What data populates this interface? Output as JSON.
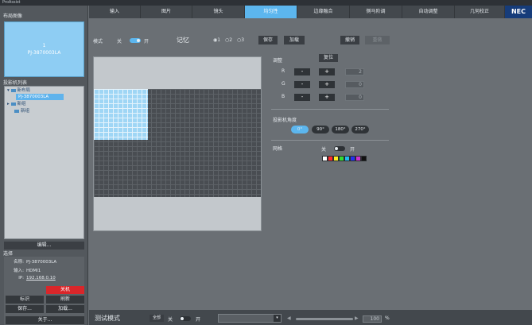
{
  "app": {
    "title": "ProAssist"
  },
  "left": {
    "layout_label": "布局图像",
    "thumbnail": {
      "number": "1",
      "device": "PJ-3870003LA"
    },
    "projector_list_label": "投影机列表",
    "tree": [
      {
        "label": "新布局"
      },
      {
        "label": "PJ-3870003LA"
      },
      {
        "label": "新组"
      },
      {
        "label": "新组"
      }
    ],
    "edit_button": "编辑...",
    "select_label": "选择",
    "info": {
      "name_key": "名称:",
      "name_val": "PJ-3870003LA",
      "input_key": "输入:",
      "input_val": "HDMI1",
      "ip_key": "IP:",
      "ip_val": "192.168.0.10"
    },
    "buttons": {
      "power_off": "关机",
      "mark": "标识",
      "refresh": "刷新",
      "save": "保存...",
      "load": "加载...",
      "about": "关于..."
    }
  },
  "tabs": [
    {
      "label": "输入"
    },
    {
      "label": "图片"
    },
    {
      "label": "镜头"
    },
    {
      "label": "均匀性"
    },
    {
      "label": "边缘融合"
    },
    {
      "label": "侧马阶调"
    },
    {
      "label": "自动调整"
    },
    {
      "label": "几何校正"
    }
  ],
  "brand": "NEC",
  "toolbar": {
    "mode_label": "模式",
    "off": "关",
    "on": "开",
    "memory_label": "记忆",
    "mem1": "1",
    "mem2": "2",
    "mem3": "3",
    "save": "保存",
    "load": "加载",
    "apply": "撤销",
    "disabled_btn": "重做"
  },
  "adjust": {
    "title": "调整",
    "reset": "复位",
    "r_label": "R",
    "g_label": "G",
    "b_label": "B",
    "minus": "-",
    "plus": "+",
    "r_val": "2",
    "g_val": "0",
    "b_val": "0"
  },
  "angle": {
    "title": "投影机角度",
    "options": [
      "0°",
      "90°",
      "180°",
      "270°"
    ]
  },
  "grid": {
    "title": "网格",
    "off": "关",
    "on": "开",
    "colors": [
      "#ffffff",
      "#ff2a2a",
      "#ffee22",
      "#33dd33",
      "#22bbee",
      "#2233ee",
      "#cc33cc",
      "#111111"
    ]
  },
  "bottom": {
    "test_mode": "测试模式",
    "all": "全部",
    "off": "关",
    "on": "开",
    "percent_val": "100",
    "percent_unit": "%"
  }
}
